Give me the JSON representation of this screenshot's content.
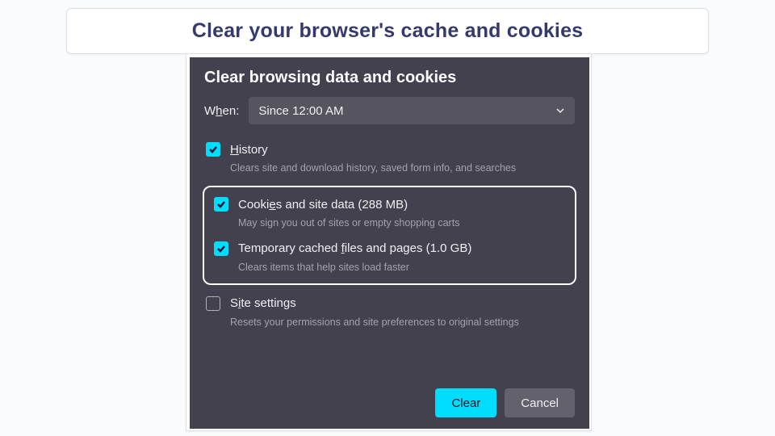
{
  "banner": "Clear your browser's cache and cookies",
  "dialog": {
    "title": "Clear browsing data and cookies",
    "when": {
      "label_pre": "W",
      "label_u": "h",
      "label_post": "en:",
      "value": "Since 12:00 AM"
    },
    "options": {
      "history": {
        "label_pre": "",
        "label_u": "H",
        "label_post": "istory",
        "desc": "Clears site and download history, saved form info, and searches",
        "checked": true
      },
      "cookies": {
        "label_pre": "Cooki",
        "label_u": "e",
        "label_post": "s and site data (288 MB)",
        "desc": "May sign you out of sites or empty shopping carts",
        "checked": true
      },
      "cache": {
        "label_pre": "Temporary cached ",
        "label_u": "f",
        "label_post": "iles and pages (1.0 GB)",
        "desc": "Clears items that help sites load faster",
        "checked": true
      },
      "site": {
        "label_pre": "S",
        "label_u": "i",
        "label_post": "te settings",
        "desc": "Resets your permissions and site preferences to original settings",
        "checked": false
      }
    },
    "buttons": {
      "clear": "Clear",
      "cancel": "Cancel"
    }
  }
}
